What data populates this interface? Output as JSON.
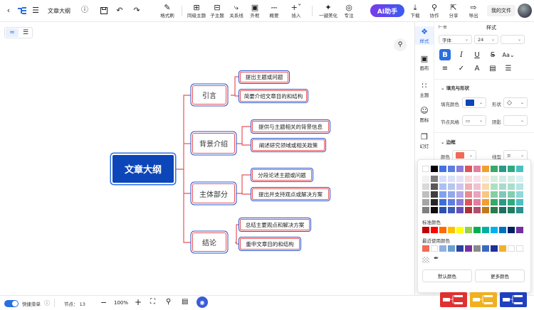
{
  "header": {
    "title": "文章大纲",
    "toolbar": [
      {
        "label": "格式刷",
        "icon": "format-painter-icon"
      },
      {
        "label": "同级主题",
        "icon": "sibling-topic-icon"
      },
      {
        "label": "子主题",
        "icon": "child-topic-icon"
      },
      {
        "label": "关系线",
        "icon": "relation-line-icon"
      },
      {
        "label": "外框",
        "icon": "boundary-icon"
      },
      {
        "label": "概要",
        "icon": "summary-icon"
      },
      {
        "label": "插入",
        "icon": "insert-icon"
      },
      {
        "label": "一键美化",
        "icon": "beautify-icon"
      },
      {
        "label": "专注",
        "icon": "focus-icon"
      }
    ],
    "ai_label": "AI助手",
    "right_tools": [
      {
        "label": "下载",
        "icon": "download-icon"
      },
      {
        "label": "协作",
        "icon": "collaborate-icon"
      },
      {
        "label": "分享",
        "icon": "share-icon"
      },
      {
        "label": "导出",
        "icon": "export-icon"
      }
    ],
    "my_files": "我的文件"
  },
  "mindmap": {
    "root": "文章大纲",
    "branches": [
      {
        "label": "引言",
        "children": [
          "提出主题或问题",
          "简要介绍文章目的和结构"
        ]
      },
      {
        "label": "背景介绍",
        "children": [
          "提供与主题相关的背景信息",
          "阐述研究领域或相关政策"
        ]
      },
      {
        "label": "主体部分",
        "children": [
          "分段论述主题或问题",
          "提出并支持观点或解决方案"
        ]
      },
      {
        "label": "结论",
        "children": [
          "总结主要观点和解决方案",
          "重申文章目的和结构"
        ]
      }
    ]
  },
  "side_nav": [
    {
      "label": "样式",
      "icon": "style-icon",
      "active": true
    },
    {
      "label": "画布",
      "icon": "canvas-icon"
    },
    {
      "label": "主题",
      "icon": "theme-icon"
    },
    {
      "label": "图标",
      "icon": "emoji-icon"
    },
    {
      "label": "幻灯",
      "icon": "slides-icon"
    }
  ],
  "style_panel": {
    "tab_title": "样式",
    "font_label": "字体",
    "font_size": "24",
    "fill_section": "填充与形状",
    "fill_color_label": "填充颜色",
    "fill_color": "#0c46b8",
    "shape_label": "形状",
    "node_style_label": "节点风格",
    "shadow_label": "阴影",
    "border_section": "边框",
    "border_color_label": "颜色",
    "border_color": "#f06a55",
    "line_label": "线型"
  },
  "color_picker": {
    "standard_label": "标准颜色",
    "recent_label": "最近使用颜色",
    "default_button": "默认颜色",
    "more_button": "更多颜色",
    "top_row": [
      "#ffffff",
      "#000000",
      "#4472e0",
      "#5b7de0",
      "#8a7cd8",
      "#e0525a",
      "#e07ea0",
      "#f0a030",
      "#3aa86a",
      "#2a9a8a",
      "#2eaa80",
      "#4ac0c0"
    ],
    "grid_columns": [
      [
        "#f2f2f2",
        "#d9d9d9",
        "#bfbfbf",
        "#a6a6a6",
        "#7f7f7f"
      ],
      [
        "#7f7f7f",
        "#595959",
        "#3f3f3f",
        "#262626",
        "#0d0d0d"
      ],
      [
        "#d4e0fa",
        "#a9c1f5",
        "#7ea2f0",
        "#3d6ee0",
        "#2a52b0"
      ],
      [
        "#dbe2f8",
        "#b7c5f1",
        "#93a8ea",
        "#5e7de0",
        "#3f5bb8"
      ],
      [
        "#e6e2f6",
        "#cdc5ee",
        "#b4a8e6",
        "#8a7cd8",
        "#6452b8"
      ],
      [
        "#f8d8da",
        "#f1b1b5",
        "#ea8a90",
        "#e0525a",
        "#b03038"
      ],
      [
        "#f8e0ea",
        "#f1c1d5",
        "#eaa2c0",
        "#e07ea0",
        "#b0506e"
      ],
      [
        "#fcecd6",
        "#f9d9ad",
        "#f6c684",
        "#f0a030",
        "#c07a18"
      ],
      [
        "#d6eedf",
        "#ade0c1",
        "#84d0a3",
        "#3aa86a",
        "#2a7c4c"
      ],
      [
        "#d4ece8",
        "#a9dad1",
        "#7ec8ba",
        "#2a9a8a",
        "#1c7064"
      ],
      [
        "#d5efe5",
        "#abdfcb",
        "#81cfb1",
        "#2eaa80",
        "#1e7e5e"
      ],
      [
        "#daf2f2",
        "#b5e5e5",
        "#90d8d8",
        "#4ac0c0",
        "#2a9090"
      ]
    ],
    "standard_colors": [
      "#c00000",
      "#ff0000",
      "#ff6a00",
      "#ffc000",
      "#ffff00",
      "#92d050",
      "#00b050",
      "#00b0a0",
      "#00b0f0",
      "#0070c0",
      "#002060",
      "#7030a0"
    ],
    "recent_colors": [
      "#f06a55",
      "#ffffff",
      "#8fb0e0",
      "#6aa0d0",
      "#2a44a0",
      "#7a30a0",
      "#8a8a8a",
      "#3a6ac0",
      "#20309a",
      "#f0b030",
      "#ffffff",
      "#ffffff"
    ]
  },
  "bottom": {
    "quick_menu_label": "快捷菜单",
    "node_label": "节点：",
    "node_count": "13",
    "zoom": "100%"
  }
}
